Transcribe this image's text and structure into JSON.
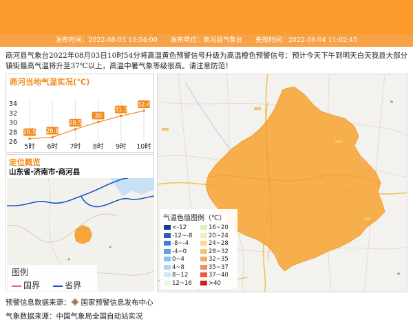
{
  "banner": {
    "publish_time_label": "发布时间：",
    "publish_time": "2022-08-03 10:54:00",
    "publisher_label": "发布单位：",
    "publisher": "商河县气象台",
    "expire_time_label": "失效时间：",
    "expire_time": "2022-08-04 11:02:45"
  },
  "description": "商河县气象台2022年08月03日10时54分将高温黄色预警信号升级为高温橙色预警信号：预计今天下午到明天白天我县大部分镇街最高气温将升至37℃以上，高温中暑气象等级很高。请注意防范！",
  "temp_panel": {
    "title": "商河当地气温实况(℃)",
    "chart_data": {
      "type": "line",
      "categories": [
        "5时",
        "6时",
        "7时",
        "8时",
        "9时",
        "10时"
      ],
      "values": [
        26.5,
        26.8,
        28.5,
        30,
        31.3,
        32.4
      ],
      "yticks": [
        "34",
        "32",
        "30",
        "28",
        "26"
      ],
      "ylim": [
        26,
        34
      ],
      "color": "#f38a1d"
    }
  },
  "location_panel": {
    "title": "定位概览",
    "location": "山东省-济南市-商河县",
    "legend_title": "图例",
    "legend_country": "国界",
    "legend_province": "省界",
    "country_color": "#d56b7c",
    "province_color": "#1f56c9"
  },
  "map_legend": {
    "title": "气温色值图例（℃）",
    "items": [
      {
        "label": "<-12",
        "color": "#1a3d8f"
      },
      {
        "label": "-12~-8",
        "color": "#2b5eb0"
      },
      {
        "label": "-8~-4",
        "color": "#3f7fd0"
      },
      {
        "label": "-4~0",
        "color": "#5ea2e6"
      },
      {
        "label": "0~4",
        "color": "#86c2f1"
      },
      {
        "label": "4~8",
        "color": "#a9d8f6"
      },
      {
        "label": "8~12",
        "color": "#cbe9f8"
      },
      {
        "label": "12~16",
        "color": "#e8f6ee"
      },
      {
        "label": "16~20",
        "color": "#d8efc2"
      },
      {
        "label": "20~24",
        "color": "#eef3b4"
      },
      {
        "label": "24~28",
        "color": "#fbd98e"
      },
      {
        "label": "28~32",
        "color": "#f9c27a"
      },
      {
        "label": "32~35",
        "color": "#f6a96c"
      },
      {
        "label": "35~37",
        "color": "#f18d5f"
      },
      {
        "label": "37~40",
        "color": "#e65841"
      },
      {
        "label": ">40",
        "color": "#d21d1d"
      }
    ]
  },
  "sources": {
    "warning_label": "预警信息数据来源：",
    "warning_source": "国家预警信息发布中心",
    "weather_label": "气象数据来源：",
    "weather_source": "中国气象局全国自动站实况"
  }
}
